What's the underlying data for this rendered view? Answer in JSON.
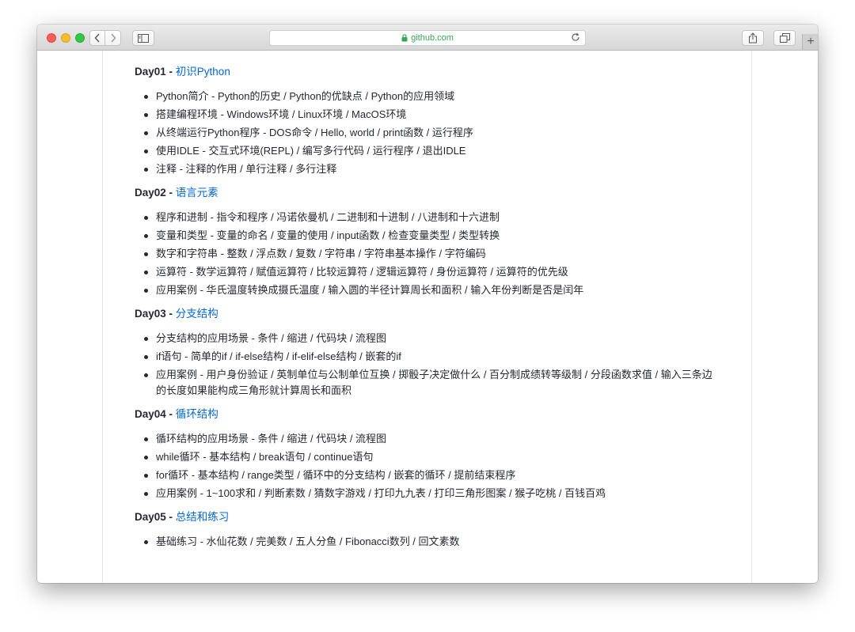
{
  "browser": {
    "url": "github.com"
  },
  "days": [
    {
      "day": "Day01",
      "separator": " - ",
      "title": "初识Python",
      "items": [
        "Python简介 - Python的历史 / Python的优缺点 / Python的应用领域",
        "搭建编程环境 - Windows环境 / Linux环境 / MacOS环境",
        "从终端运行Python程序 - DOS命令 / Hello, world / print函数 / 运行程序",
        "使用IDLE - 交互式环境(REPL) / 编写多行代码 / 运行程序 / 退出IDLE",
        "注释 - 注释的作用 / 单行注释 / 多行注释"
      ]
    },
    {
      "day": "Day02",
      "separator": " - ",
      "title": "语言元素",
      "items": [
        "程序和进制 - 指令和程序 / 冯诺依曼机 / 二进制和十进制 / 八进制和十六进制",
        "变量和类型 - 变量的命名 / 变量的使用 / input函数 / 检查变量类型 / 类型转换",
        "数字和字符串 - 整数 / 浮点数 / 复数 / 字符串 / 字符串基本操作 / 字符编码",
        "运算符 - 数学运算符 / 赋值运算符 / 比较运算符 / 逻辑运算符 / 身份运算符 / 运算符的优先级",
        "应用案例 - 华氏温度转换成摄氏温度 / 输入圆的半径计算周长和面积 / 输入年份判断是否是闰年"
      ]
    },
    {
      "day": "Day03",
      "separator": " - ",
      "title": "分支结构",
      "items": [
        "分支结构的应用场景 - 条件 / 缩进 / 代码块 / 流程图",
        "if语句 - 简单的if / if-else结构 / if-elif-else结构 / 嵌套的if",
        "应用案例 - 用户身份验证 / 英制单位与公制单位互换 / 掷骰子决定做什么 / 百分制成绩转等级制 / 分段函数求值 / 输入三条边的长度如果能构成三角形就计算周长和面积"
      ]
    },
    {
      "day": "Day04",
      "separator": " - ",
      "title": "循环结构",
      "items": [
        "循环结构的应用场景 - 条件 / 缩进 / 代码块 / 流程图",
        "while循环 - 基本结构 / break语句 / continue语句",
        "for循环 - 基本结构 / range类型 / 循环中的分支结构 / 嵌套的循环 / 提前结束程序",
        "应用案例 - 1~100求和 / 判断素数 / 猜数字游戏 / 打印九九表 / 打印三角形图案 / 猴子吃桃 / 百钱百鸡"
      ]
    },
    {
      "day": "Day05",
      "separator": " - ",
      "title": "总结和练习",
      "items": [
        "基础练习 - 水仙花数 / 完美数 / 五人分鱼 / Fibonacci数列 / 回文素数"
      ]
    }
  ]
}
